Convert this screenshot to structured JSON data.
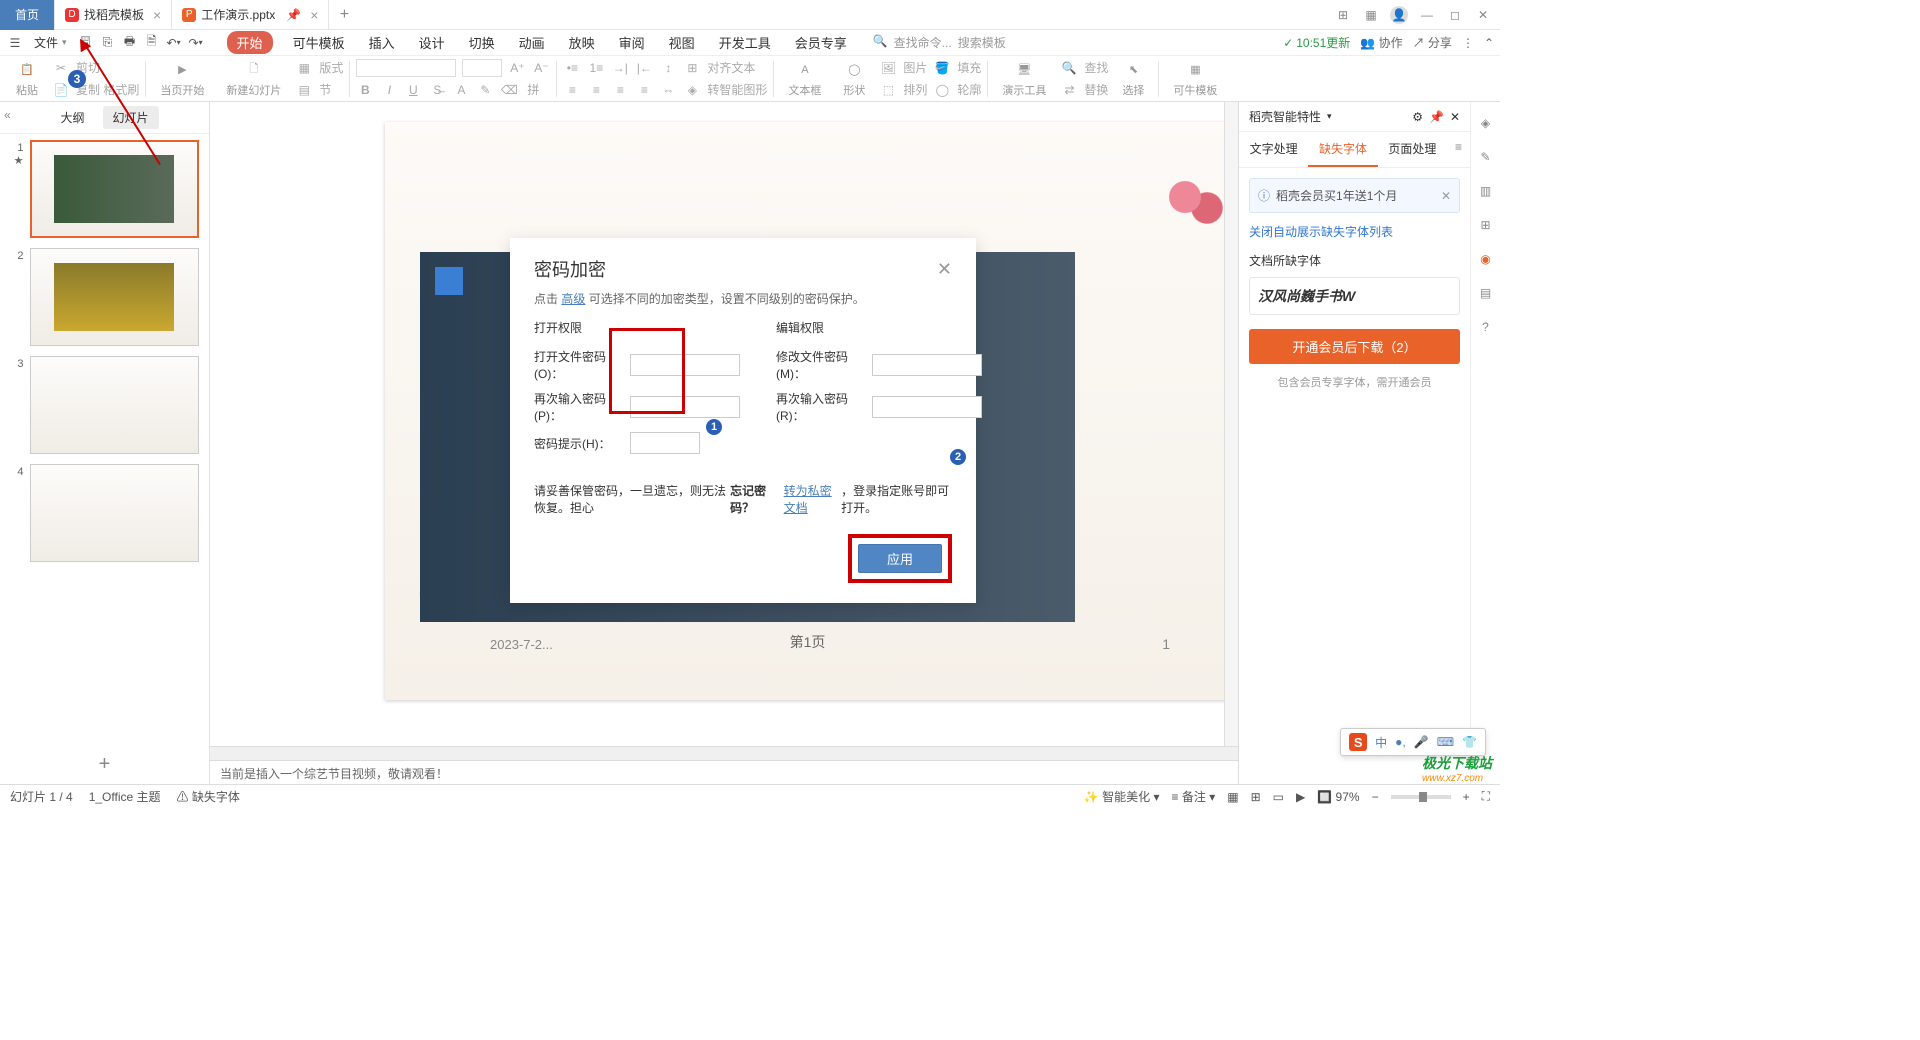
{
  "titlebar": {
    "home": "首页",
    "tab1": "找稻壳模板",
    "tab2": "工作演示.pptx"
  },
  "menubar": {
    "file": "文件",
    "tabs": [
      "开始",
      "可牛模板",
      "插入",
      "设计",
      "切换",
      "动画",
      "放映",
      "审阅",
      "视图",
      "开发工具",
      "会员专享"
    ],
    "search_cmd": "查找命令...",
    "search_tpl": "搜索模板",
    "time_update": "10:51更新",
    "collab": "协作",
    "share": "分享"
  },
  "ribbon": {
    "paste": "粘贴",
    "cut": "剪切",
    "copy_fmt": "复制 格式刷",
    "play_here": "当页开始",
    "new_slide": "新建幻灯片",
    "layout": "版式",
    "section": "节",
    "align": "对齐文本",
    "smart_shape": "转智能图形",
    "textbox": "文本框",
    "shape": "形状",
    "arrange": "排列",
    "outline": "轮廓",
    "present_tool": "演示工具",
    "find": "查找",
    "replace": "替换",
    "select": "选择",
    "kn_tpl": "可牛模板"
  },
  "leftpanel": {
    "tab_outline": "大纲",
    "tab_slides": "幻灯片"
  },
  "slide": {
    "date": "2023-7-2...",
    "page_center": "第1页",
    "page_right": "1"
  },
  "notebar": "当前是插入一个综艺节目视频，敬请观看！",
  "rightpanel": {
    "title": "稻壳智能特性",
    "tab1": "文字处理",
    "tab2": "缺失字体",
    "tab3": "页面处理",
    "promo": "稻壳会员买1年送1个月",
    "link_close": "关闭自动展示缺失字体列表",
    "section": "文档所缺字体",
    "font1": "汉风尚巍手书W",
    "download_btn": "开通会员后下载（2）",
    "hint": "包含会员专享字体，需开通会员"
  },
  "modal": {
    "title": "密码加密",
    "sub_pre": "点击 ",
    "sub_link": "高级",
    "sub_post": " 可选择不同的加密类型，设置不同级别的密码保护。",
    "open_perm": "打开权限",
    "edit_perm": "编辑权限",
    "open_pwd": "打开文件密码(O)：",
    "open_pwd2": "再次输入密码(P)：",
    "pwd_hint": "密码提示(H)：",
    "edit_pwd": "修改文件密码(M)：",
    "edit_pwd2": "再次输入密码(R)：",
    "warn_pre": "请妥善保管密码，一旦遗忘，则无法恢复。担心",
    "warn_bold": "忘记密码？",
    "warn_link": "转为私密文档",
    "warn_post": "，登录指定账号即可打开。",
    "apply": "应用"
  },
  "statusbar": {
    "slide_info": "幻灯片 1 / 4",
    "theme": "1_Office 主题",
    "missing_font": "缺失字体",
    "beautify": "智能美化",
    "notes": "备注",
    "zoom": "97%"
  },
  "float": {
    "chinese": "中"
  },
  "watermark": {
    "line1": "极光下载站",
    "line2": "www.xz7.com"
  }
}
